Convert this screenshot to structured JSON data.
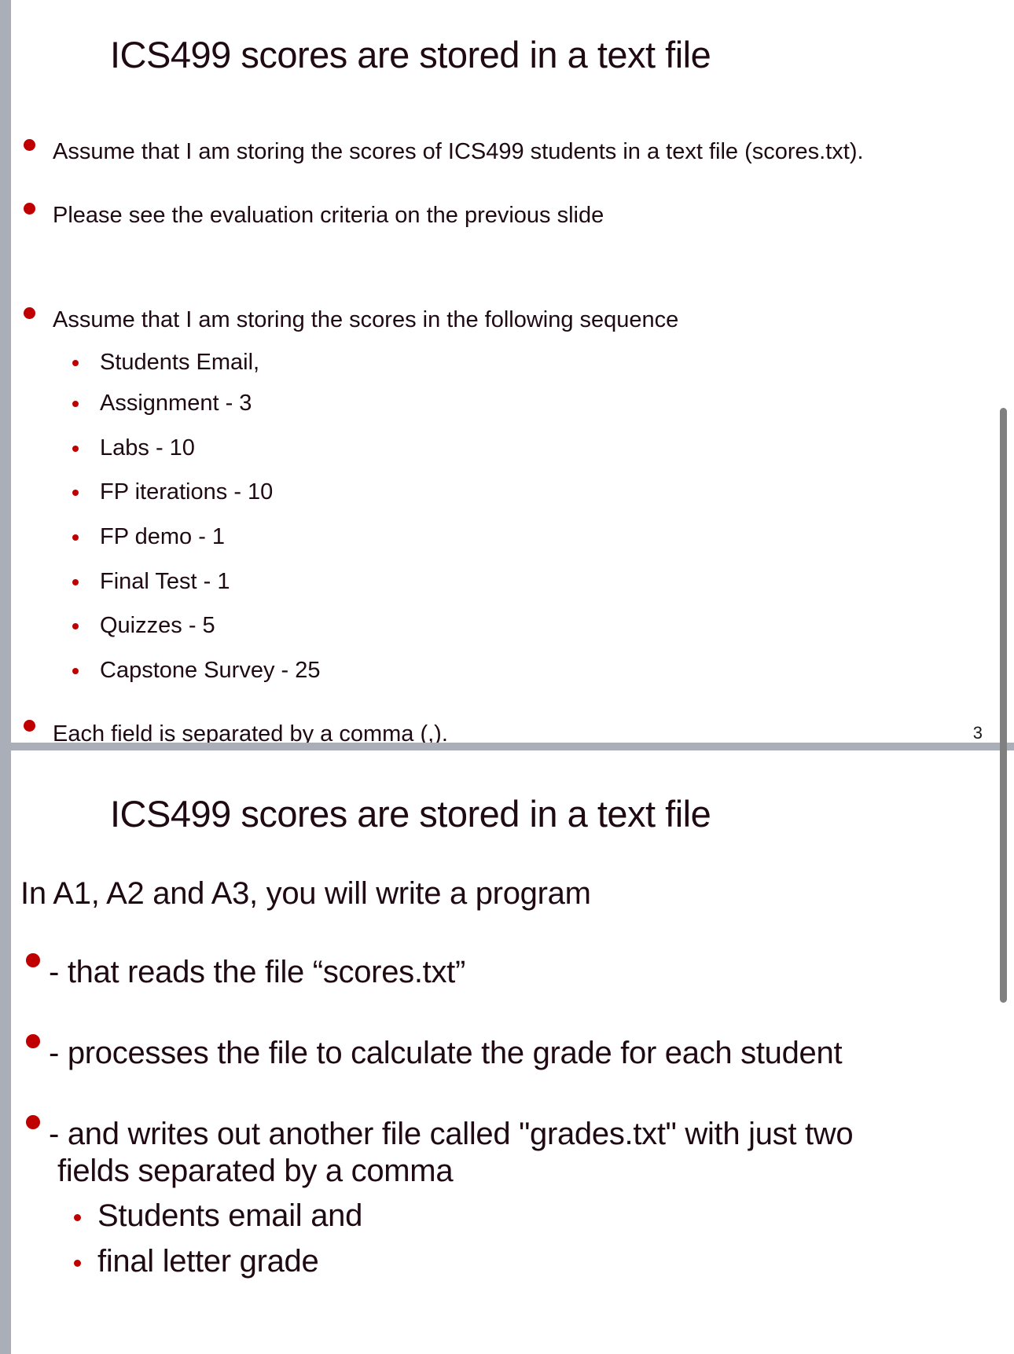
{
  "slides": [
    {
      "title": "ICS499 scores are stored in a text file",
      "bullets": [
        "Assume that I am storing the scores of ICS499 students in a text file (scores.txt).",
        "Please see the evaluation criteria on the previous slide",
        "Assume that I am storing the scores in the following sequence"
      ],
      "sequence_items": [
        "Students Email,",
        "Assignment - 3",
        "Labs - 10",
        "FP iterations - 10",
        "FP demo - 1",
        "Final Test - 1",
        "Quizzes - 5",
        "Capstone Survey - 25"
      ],
      "last_bullet": "Each field is separated by a comma (,).",
      "page_number": "3"
    },
    {
      "title": "ICS499 scores are stored in a text file",
      "intro": "In A1, A2 and A3, you will write a program",
      "bullets": [
        "- that reads the file  “scores.txt”",
        "- processes the file to calculate the grade for each student",
        "- and writes out another file called \"grades.txt\" with just two",
        "fields separated by a comma"
      ],
      "sub_items": [
        "Students email and",
        "final letter grade"
      ]
    }
  ],
  "colors": {
    "bullet": "#c00000",
    "text": "#1f0a14",
    "gutter": "#a9aeb8",
    "scrollbar": "#808080"
  }
}
